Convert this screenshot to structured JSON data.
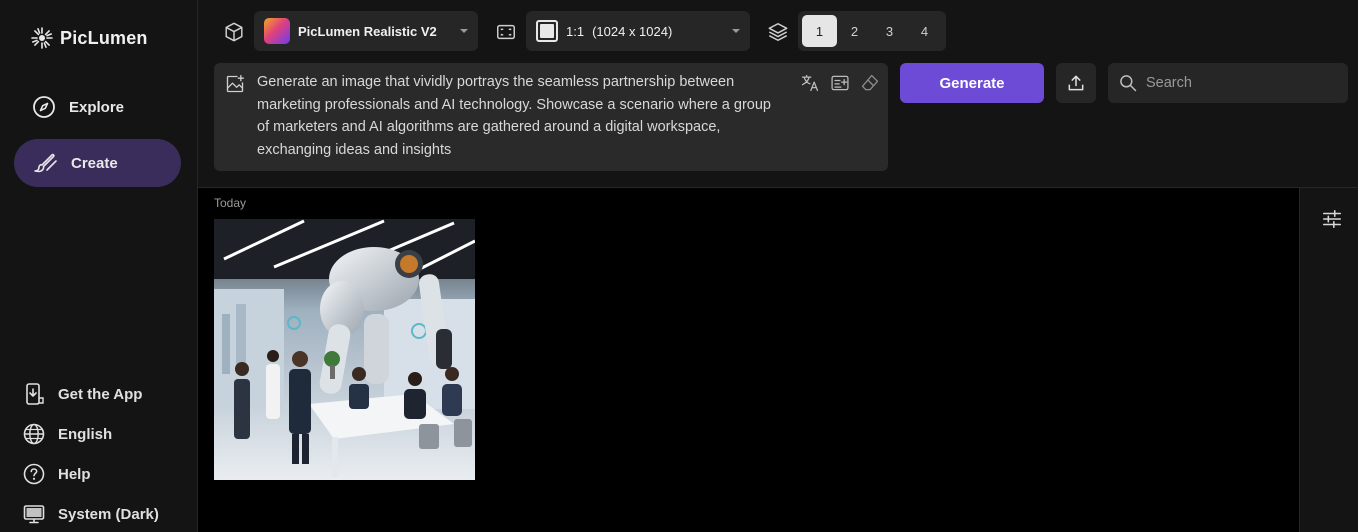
{
  "app": {
    "name": "PicLumen"
  },
  "nav": {
    "explore": "Explore",
    "create": "Create"
  },
  "bottom_nav": {
    "get_app": "Get the App",
    "language": "English",
    "help": "Help",
    "theme": "System (Dark)"
  },
  "toolbar": {
    "model": "PicLumen Realistic V2",
    "ratio": "1:1",
    "ratio_size": "(1024 x 1024)",
    "counts": [
      "1",
      "2",
      "3",
      "4"
    ],
    "selected_count": "1"
  },
  "prompt": {
    "text": "Generate an image that vividly portrays the seamless partnership between marketing professionals and AI technology. Showcase a scenario where a group of marketers and AI algorithms are gathered around a digital workspace, exchanging ideas and insights"
  },
  "actions": {
    "generate_label": "Generate",
    "search_placeholder": "Search"
  },
  "gallery": {
    "date_label": "Today"
  },
  "colors": {
    "accent": "#6d4bd6",
    "active_nav": "#3a2d5c",
    "sidebar_bg": "#141414"
  }
}
